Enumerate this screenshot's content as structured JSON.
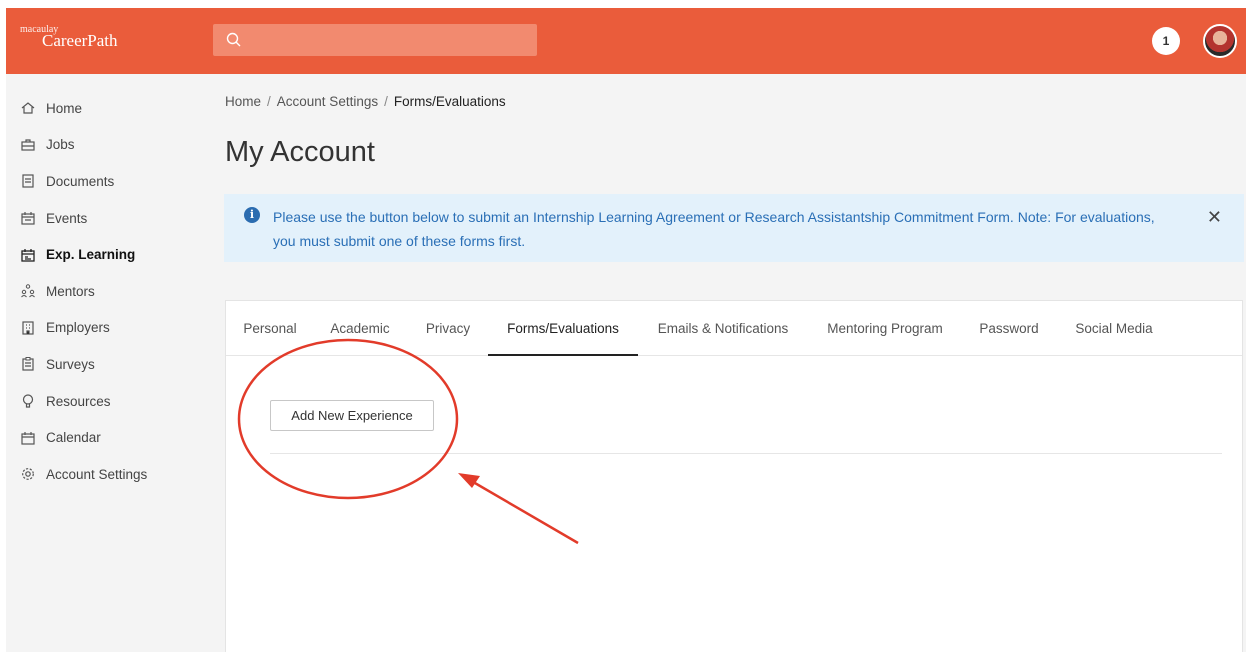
{
  "header": {
    "logo_small": "macaulay",
    "logo_big": "CareerPath",
    "search_placeholder": "",
    "notification_count": "1",
    "brand_color": "#ea5c3b"
  },
  "sidebar": {
    "items": [
      {
        "label": "Home",
        "icon": "home-icon"
      },
      {
        "label": "Jobs",
        "icon": "briefcase-icon"
      },
      {
        "label": "Documents",
        "icon": "document-icon"
      },
      {
        "label": "Events",
        "icon": "calendar-event-icon"
      },
      {
        "label": "Exp. Learning",
        "icon": "exp-learning-icon",
        "active": true
      },
      {
        "label": "Mentors",
        "icon": "people-icon"
      },
      {
        "label": "Employers",
        "icon": "building-icon"
      },
      {
        "label": "Surveys",
        "icon": "clipboard-icon"
      },
      {
        "label": "Resources",
        "icon": "lightbulb-icon"
      },
      {
        "label": "Calendar",
        "icon": "calendar-icon"
      },
      {
        "label": "Account Settings",
        "icon": "gear-icon"
      }
    ]
  },
  "breadcrumb": {
    "items": [
      "Home",
      "Account Settings",
      "Forms/Evaluations"
    ],
    "separator": "/"
  },
  "page": {
    "title": "My Account"
  },
  "alert": {
    "message": "Please use the button below to submit an Internship Learning Agreement or Research Assistantship Commitment Form. Note: For evaluations, you must submit one of these forms first.",
    "close_label": "✕",
    "info_label": "i",
    "color": "#2a6fb6",
    "background": "#e3f1fb"
  },
  "tabs": [
    {
      "label": "Personal"
    },
    {
      "label": "Academic"
    },
    {
      "label": "Privacy"
    },
    {
      "label": "Forms/Evaluations",
      "active": true
    },
    {
      "label": "Emails & Notifications"
    },
    {
      "label": "Mentoring Program"
    },
    {
      "label": "Password"
    },
    {
      "label": "Social Media"
    }
  ],
  "content": {
    "add_button_label": "Add New Experience"
  },
  "annotation": {
    "color": "#e23b2a",
    "shapes": [
      "circle",
      "arrow"
    ]
  }
}
